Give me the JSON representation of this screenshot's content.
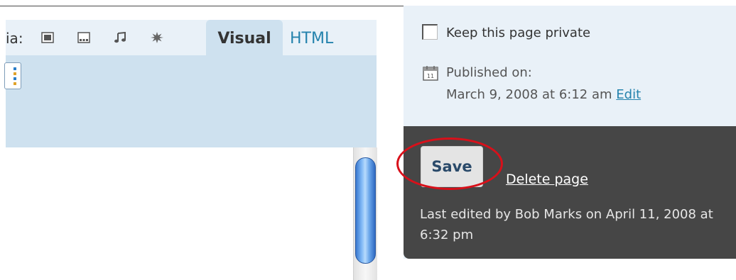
{
  "editor": {
    "media_label": "ia:",
    "media_icons": [
      "image-icon",
      "gallery-icon",
      "music-icon",
      "star-burst-icon"
    ],
    "tabs": {
      "visual": "Visual",
      "html": "HTML"
    }
  },
  "publish": {
    "private_label": "Keep this page private",
    "published_label": "Published on:",
    "published_date": "March 9, 2008 at 6:12 am",
    "edit_label": "Edit",
    "save_label": "Save",
    "delete_label": "Delete page",
    "last_edited": "Last edited by Bob Marks on April 11, 2008 at 6:32 pm"
  },
  "colors": {
    "panel_bg": "#e9f1f8",
    "dark_bg": "#464646",
    "link": "#2583ad",
    "highlight": "#d8101a"
  }
}
